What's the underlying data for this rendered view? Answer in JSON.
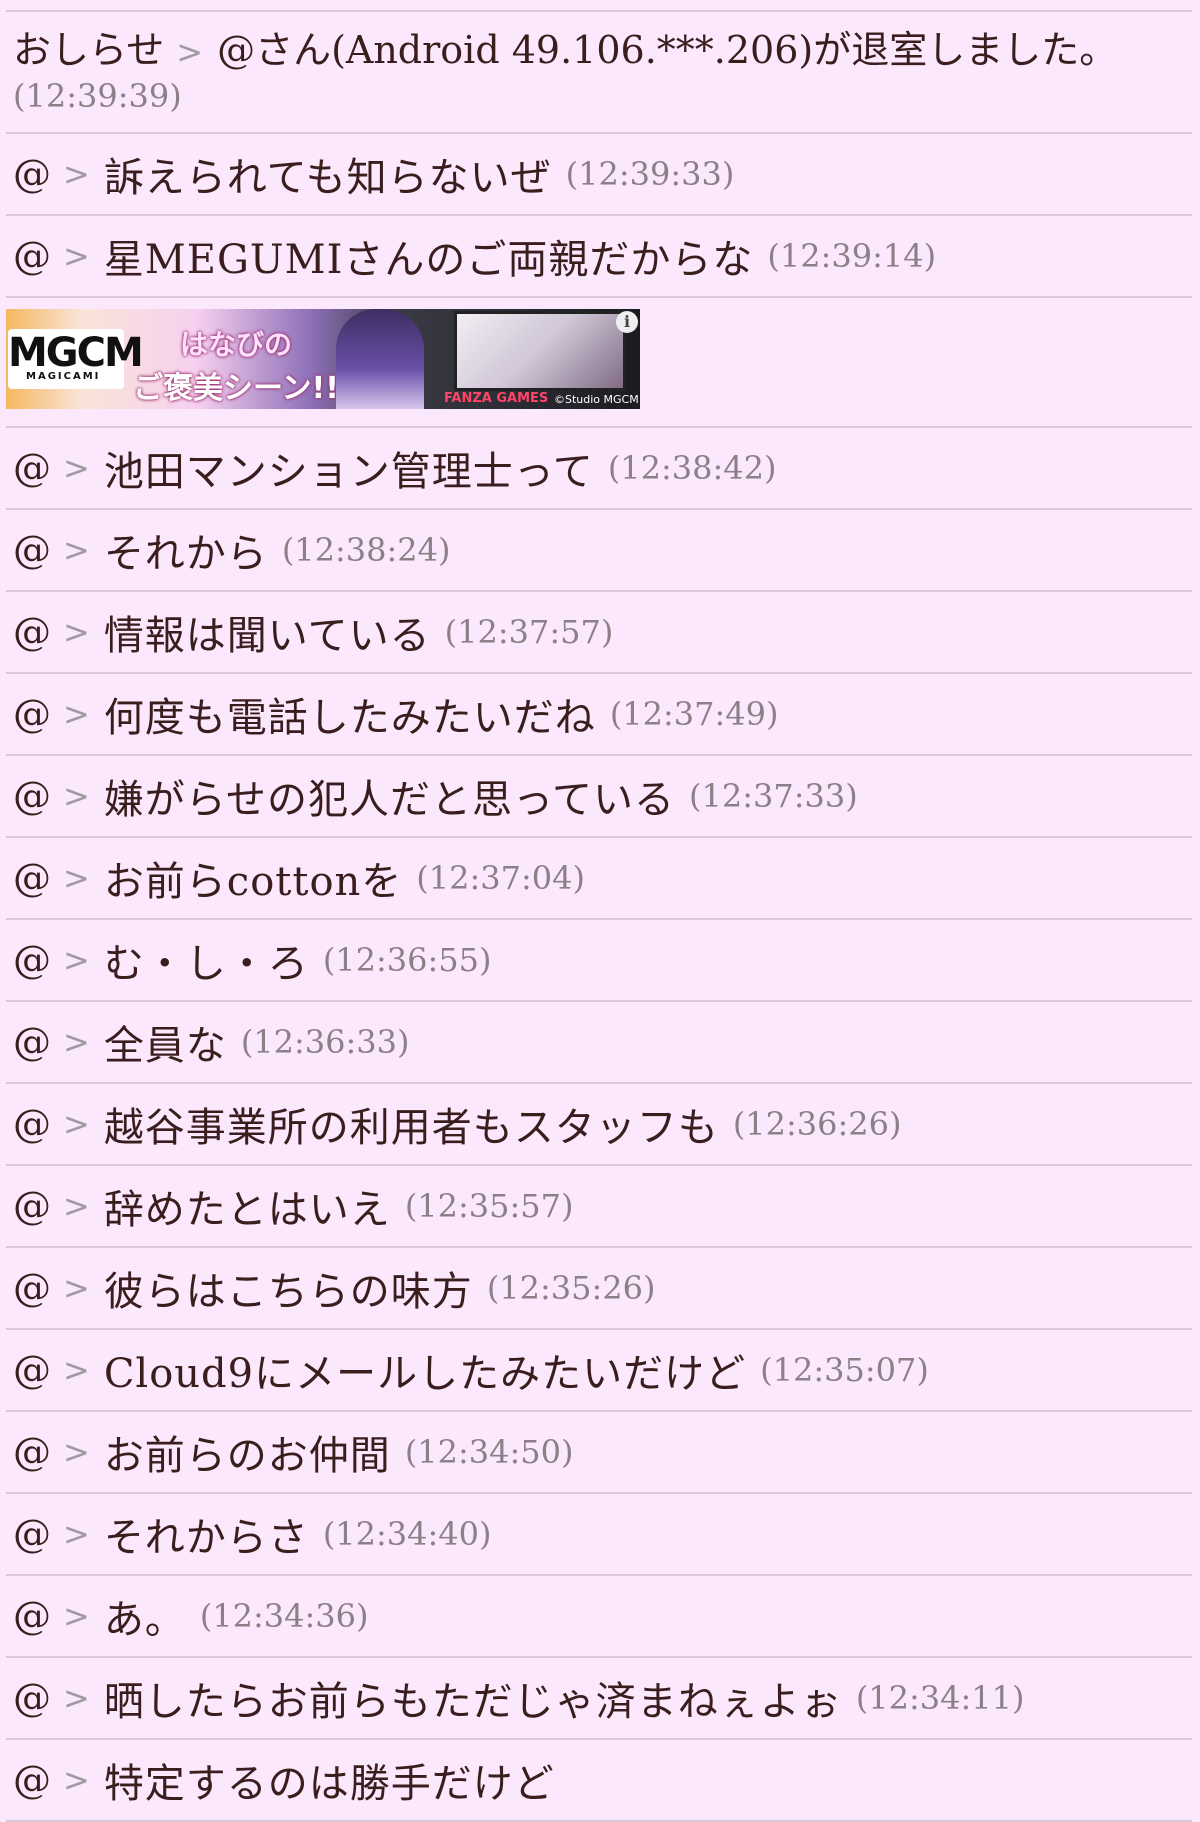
{
  "notice": {
    "name": "おしらせ",
    "separator": ">",
    "text": "@さん(Android 49.106.***.206)が退室しました。",
    "time": "(12:39:39)"
  },
  "messages_before_ad": [
    {
      "name": "@",
      "separator": ">",
      "text": "訴えられても知らないぜ",
      "time": "(12:39:33)"
    },
    {
      "name": "@",
      "separator": ">",
      "text": "星MEGUMIさんのご両親だからな",
      "time": "(12:39:14)"
    }
  ],
  "ad": {
    "logo": "MGCM",
    "logo_sub": "MAGICAMI",
    "caption_line1": "はなびの",
    "caption_line2": "ご褒美シーン!!",
    "publisher": "FANZA GAMES",
    "copyright": "©Studio MGCM",
    "info": "i"
  },
  "messages_after_ad": [
    {
      "name": "@",
      "separator": ">",
      "text": "池田マンション管理士って",
      "time": "(12:38:42)"
    },
    {
      "name": "@",
      "separator": ">",
      "text": "それから",
      "time": "(12:38:24)"
    },
    {
      "name": "@",
      "separator": ">",
      "text": "情報は聞いている",
      "time": "(12:37:57)"
    },
    {
      "name": "@",
      "separator": ">",
      "text": "何度も電話したみたいだね",
      "time": "(12:37:49)"
    },
    {
      "name": "@",
      "separator": ">",
      "text": "嫌がらせの犯人だと思っている",
      "time": "(12:37:33)"
    },
    {
      "name": "@",
      "separator": ">",
      "text": "お前らcottonを",
      "time": "(12:37:04)"
    },
    {
      "name": "@",
      "separator": ">",
      "text": "む・し・ろ",
      "time": "(12:36:55)"
    },
    {
      "name": "@",
      "separator": ">",
      "text": "全員な",
      "time": "(12:36:33)"
    },
    {
      "name": "@",
      "separator": ">",
      "text": "越谷事業所の利用者もスタッフも",
      "time": "(12:36:26)"
    },
    {
      "name": "@",
      "separator": ">",
      "text": "辞めたとはいえ",
      "time": "(12:35:57)"
    },
    {
      "name": "@",
      "separator": ">",
      "text": "彼らはこちらの味方",
      "time": "(12:35:26)"
    },
    {
      "name": "@",
      "separator": ">",
      "text": "Cloud9にメールしたみたいだけど",
      "time": "(12:35:07)"
    },
    {
      "name": "@",
      "separator": ">",
      "text": "お前らのお仲間",
      "time": "(12:34:50)"
    },
    {
      "name": "@",
      "separator": ">",
      "text": "それからさ",
      "time": "(12:34:40)"
    },
    {
      "name": "@",
      "separator": ">",
      "text": "あ。",
      "time": "(12:34:36)"
    },
    {
      "name": "@",
      "separator": ">",
      "text": "晒したらお前らもただじゃ済まねぇよぉ",
      "time": "(12:34:11)"
    },
    {
      "name": "@",
      "separator": ">",
      "text": "特定するのは勝手だけど",
      "time": ""
    }
  ]
}
